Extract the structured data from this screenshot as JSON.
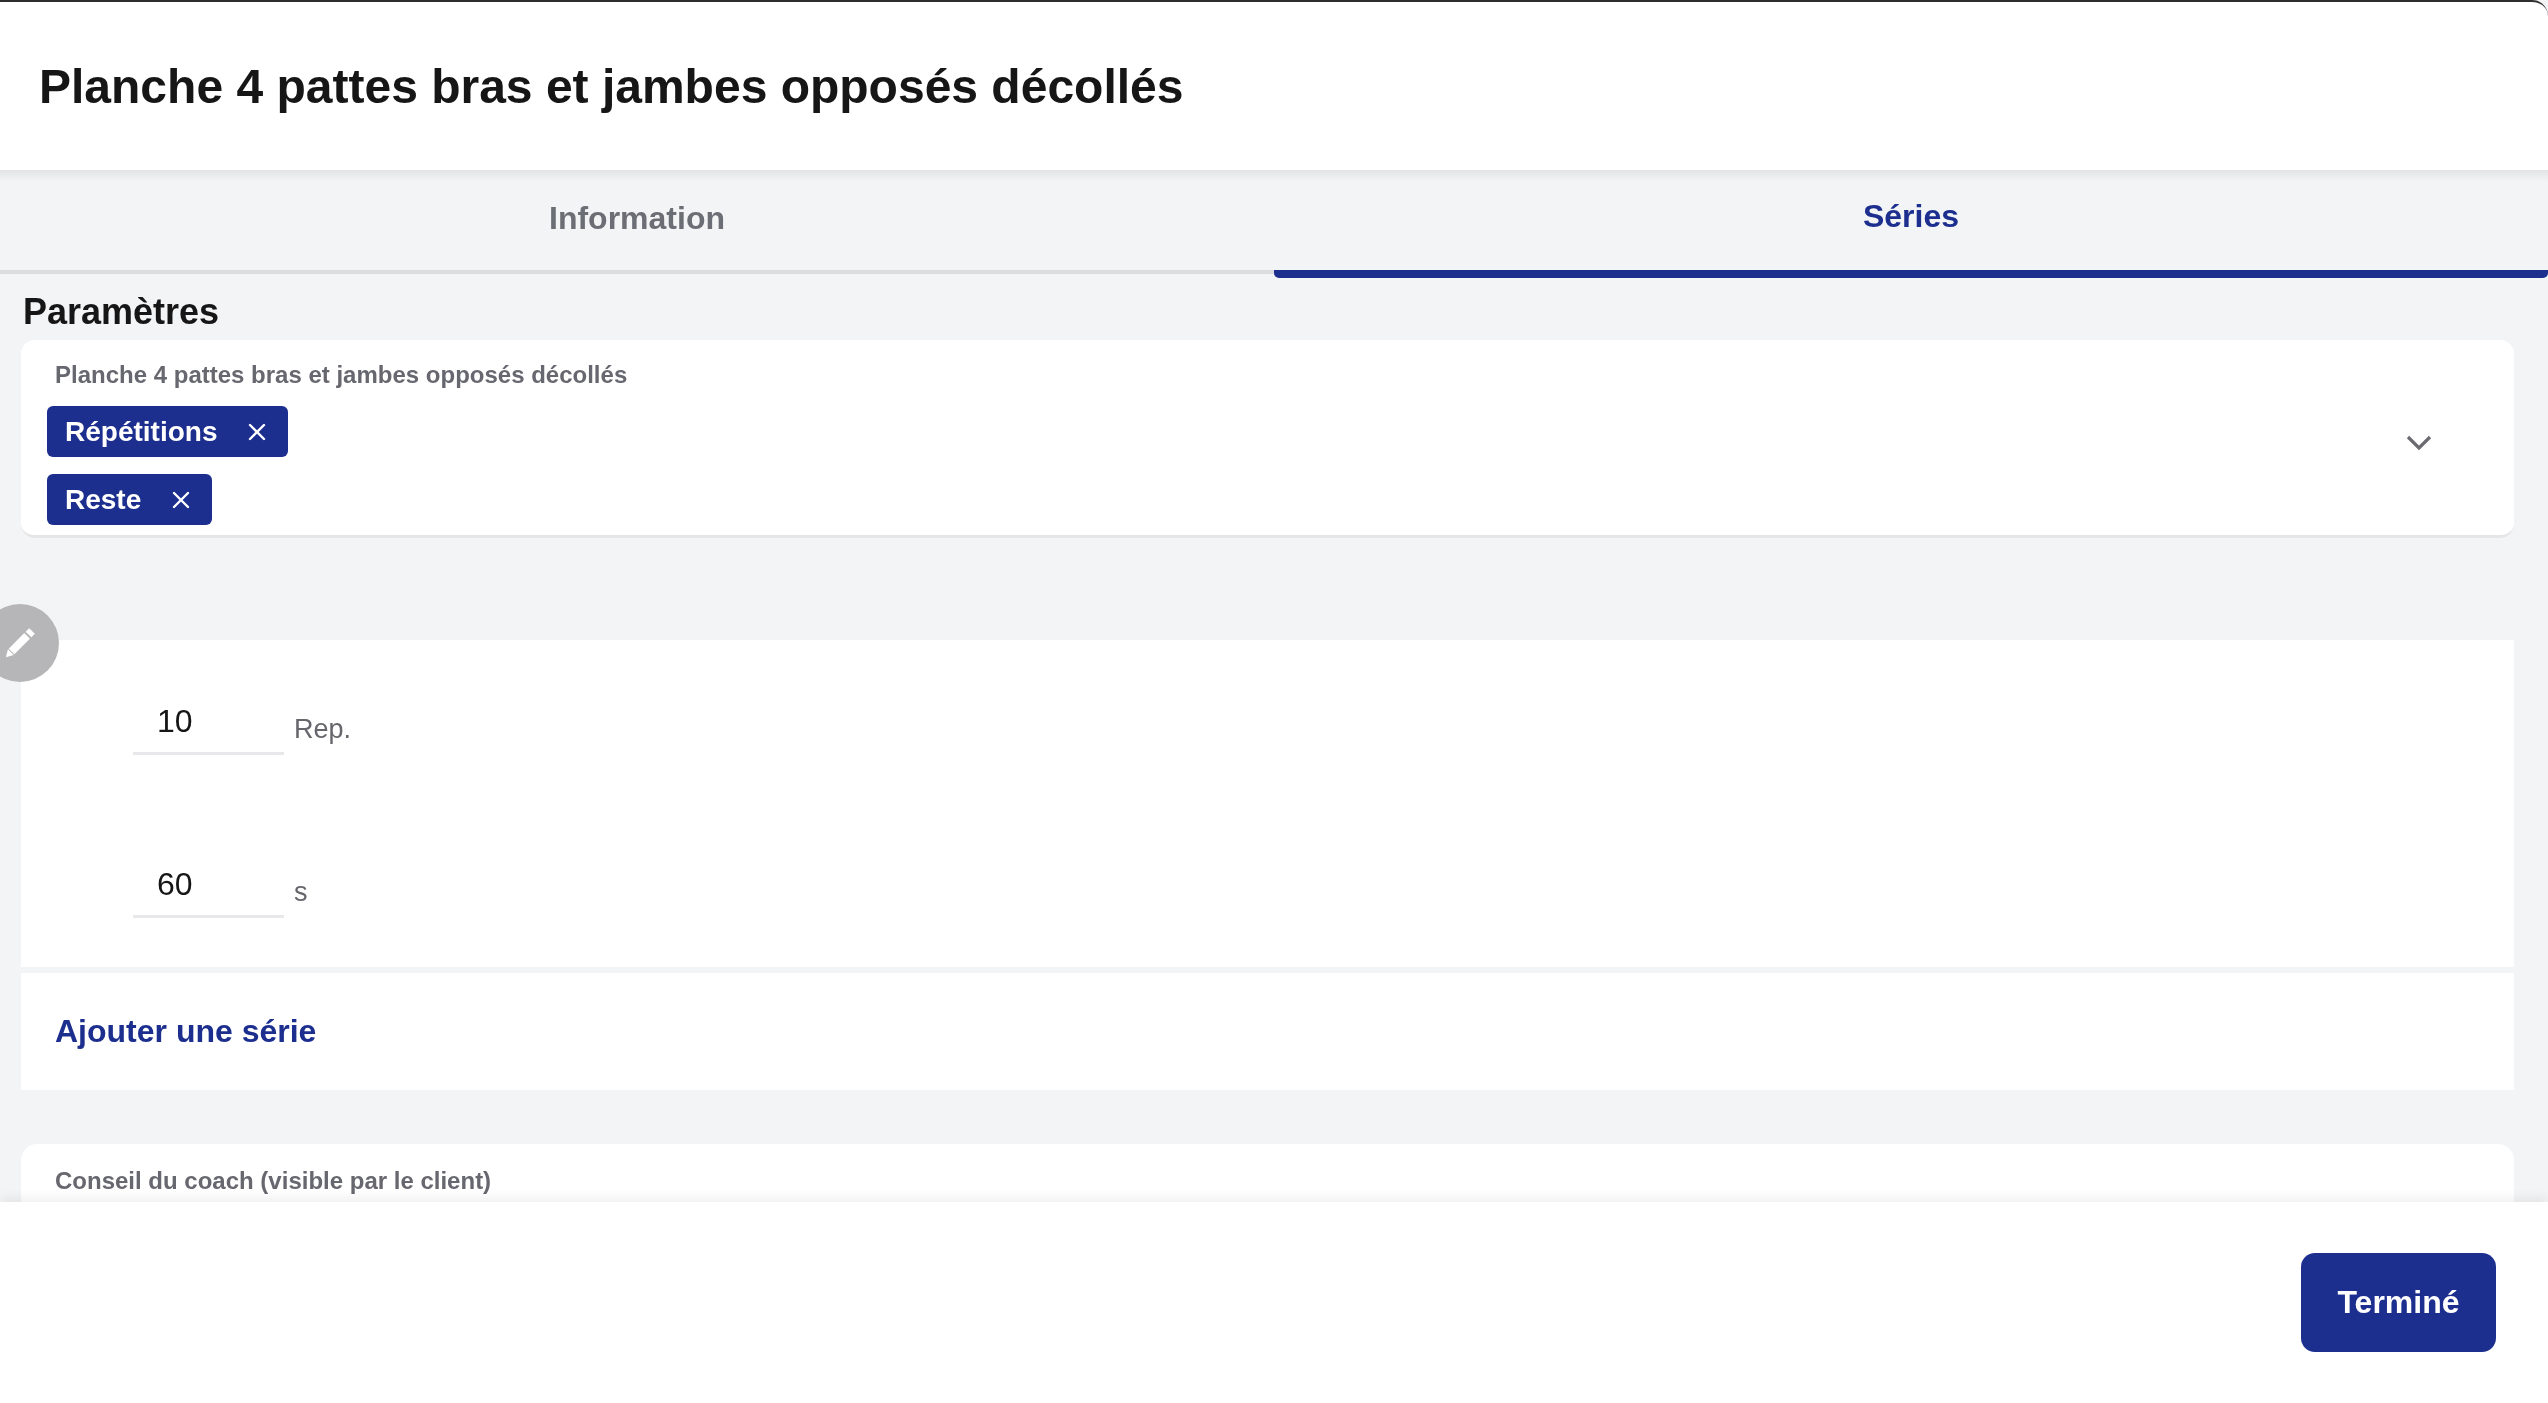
{
  "header": {
    "title": "Planche 4 pattes bras et jambes opposés décollés"
  },
  "tabs": [
    {
      "label": "Information",
      "selected": false
    },
    {
      "label": "Séries",
      "selected": true
    }
  ],
  "parameters": {
    "heading": "Paramètres",
    "exercise": "Planche 4 pattes bras et jambes opposés décollés",
    "chips": [
      "Répétitions",
      "Reste"
    ]
  },
  "series": [
    {
      "fields": [
        {
          "value": "10",
          "unit": "Rep."
        },
        {
          "value": "60",
          "unit": "s"
        }
      ]
    }
  ],
  "add_series": {
    "label": "Ajouter une série"
  },
  "coach_advice": {
    "label": "Conseil du coach (visible par le client)"
  },
  "footer": {
    "done_button": "Terminé"
  }
}
